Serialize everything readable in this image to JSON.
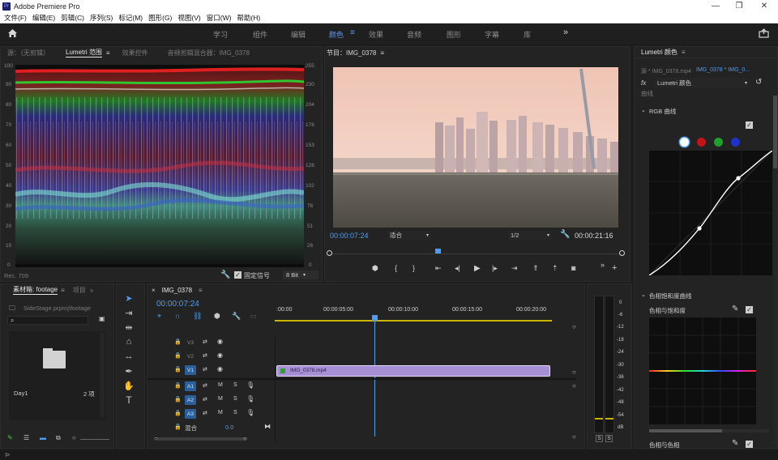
{
  "app": {
    "title": "Adobe Premiere Pro",
    "icon_text": "Pr"
  },
  "menu": [
    "文件(F)",
    "编辑(E)",
    "剪辑(C)",
    "序列(S)",
    "标记(M)",
    "图形(G)",
    "视图(V)",
    "窗口(W)",
    "帮助(H)"
  ],
  "workspaces": [
    "学习",
    "组件",
    "编辑",
    "颜色",
    "效果",
    "音频",
    "图形",
    "字幕",
    "库"
  ],
  "active_workspace": "颜色",
  "left_panel": {
    "tabs": [
      "源：（无剪辑）",
      "Lumetri 范围",
      "效果控件",
      "音频剪辑混合器：IMG_0378"
    ],
    "active_tab": "Lumetri 范围",
    "left_axis": [
      "100",
      "90",
      "80",
      "70",
      "60",
      "50",
      "40",
      "30",
      "20",
      "10",
      "0"
    ],
    "right_axis": [
      "255",
      "230",
      "204",
      "178",
      "153",
      "128",
      "102",
      "76",
      "51",
      "26",
      "0"
    ],
    "footer_left": "Rec. 709",
    "clamp_label": "固定信号",
    "bit_depth": "8 Bit"
  },
  "program": {
    "title": "节目：IMG_0378",
    "timecode": "00:00:07:24",
    "fit": "适合",
    "resolution": "1/2",
    "duration": "00:00:21:16",
    "playhead_fraction": 0.37
  },
  "lumetri": {
    "title": "Lumetri 颜色",
    "source": "源 * IMG_0378.mp4",
    "sequence": "IMG_0378 * IMG_0...",
    "fx_label": "fx",
    "effect": "Lumetri 颜色",
    "curves_label": "曲线",
    "rgb_curves": "RGB 曲线",
    "hue_section": "色相饱和度曲线",
    "hue_vs_sat": "色相与饱和度",
    "hue_vs_hue": "色相与色相",
    "channel_colors": [
      "#ffffff",
      "#c0141a",
      "#1fa12d",
      "#1f33c8"
    ]
  },
  "project": {
    "title": "素材箱: footage",
    "tab2": "项目",
    "path": "SideStage.prproj\\footage",
    "bin_name": "Day1",
    "bin_count": "2 项"
  },
  "timeline": {
    "title": "IMG_0378",
    "timecode": "00:00:07:24",
    "ruler": [
      ":00:00",
      "00:00:05:00",
      "00:00:10:00",
      "00:00:15:00",
      "00:00:20:00"
    ],
    "video_tracks": [
      "V3",
      "V2",
      "V1"
    ],
    "audio_tracks": [
      "A1",
      "A2",
      "A3"
    ],
    "mix_label": "混合",
    "mix_value": "0.0",
    "clip_name": "IMG_0378.mp4",
    "mute": "M",
    "solo": "S"
  },
  "meter": {
    "scale": [
      "0",
      "-6",
      "-12",
      "-18",
      "-24",
      "-30",
      "-36",
      "-42",
      "-48",
      "-54",
      "dB"
    ],
    "solo_left": "S",
    "solo_right": "S"
  }
}
